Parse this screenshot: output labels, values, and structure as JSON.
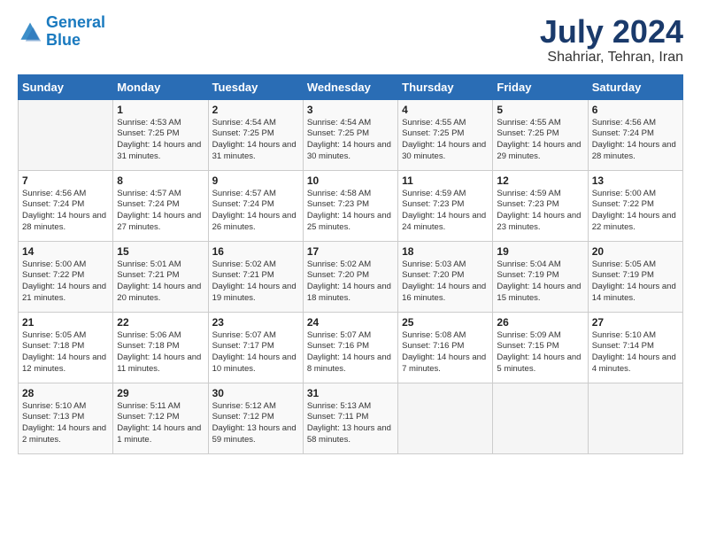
{
  "logo": {
    "line1": "General",
    "line2": "Blue"
  },
  "title": {
    "month_year": "July 2024",
    "location": "Shahriar, Tehran, Iran"
  },
  "headers": [
    "Sunday",
    "Monday",
    "Tuesday",
    "Wednesday",
    "Thursday",
    "Friday",
    "Saturday"
  ],
  "weeks": [
    [
      {
        "day": "",
        "sunrise": "",
        "sunset": "",
        "daylight": ""
      },
      {
        "day": "1",
        "sunrise": "Sunrise: 4:53 AM",
        "sunset": "Sunset: 7:25 PM",
        "daylight": "Daylight: 14 hours and 31 minutes."
      },
      {
        "day": "2",
        "sunrise": "Sunrise: 4:54 AM",
        "sunset": "Sunset: 7:25 PM",
        "daylight": "Daylight: 14 hours and 31 minutes."
      },
      {
        "day": "3",
        "sunrise": "Sunrise: 4:54 AM",
        "sunset": "Sunset: 7:25 PM",
        "daylight": "Daylight: 14 hours and 30 minutes."
      },
      {
        "day": "4",
        "sunrise": "Sunrise: 4:55 AM",
        "sunset": "Sunset: 7:25 PM",
        "daylight": "Daylight: 14 hours and 30 minutes."
      },
      {
        "day": "5",
        "sunrise": "Sunrise: 4:55 AM",
        "sunset": "Sunset: 7:25 PM",
        "daylight": "Daylight: 14 hours and 29 minutes."
      },
      {
        "day": "6",
        "sunrise": "Sunrise: 4:56 AM",
        "sunset": "Sunset: 7:24 PM",
        "daylight": "Daylight: 14 hours and 28 minutes."
      }
    ],
    [
      {
        "day": "7",
        "sunrise": "Sunrise: 4:56 AM",
        "sunset": "Sunset: 7:24 PM",
        "daylight": "Daylight: 14 hours and 28 minutes."
      },
      {
        "day": "8",
        "sunrise": "Sunrise: 4:57 AM",
        "sunset": "Sunset: 7:24 PM",
        "daylight": "Daylight: 14 hours and 27 minutes."
      },
      {
        "day": "9",
        "sunrise": "Sunrise: 4:57 AM",
        "sunset": "Sunset: 7:24 PM",
        "daylight": "Daylight: 14 hours and 26 minutes."
      },
      {
        "day": "10",
        "sunrise": "Sunrise: 4:58 AM",
        "sunset": "Sunset: 7:23 PM",
        "daylight": "Daylight: 14 hours and 25 minutes."
      },
      {
        "day": "11",
        "sunrise": "Sunrise: 4:59 AM",
        "sunset": "Sunset: 7:23 PM",
        "daylight": "Daylight: 14 hours and 24 minutes."
      },
      {
        "day": "12",
        "sunrise": "Sunrise: 4:59 AM",
        "sunset": "Sunset: 7:23 PM",
        "daylight": "Daylight: 14 hours and 23 minutes."
      },
      {
        "day": "13",
        "sunrise": "Sunrise: 5:00 AM",
        "sunset": "Sunset: 7:22 PM",
        "daylight": "Daylight: 14 hours and 22 minutes."
      }
    ],
    [
      {
        "day": "14",
        "sunrise": "Sunrise: 5:00 AM",
        "sunset": "Sunset: 7:22 PM",
        "daylight": "Daylight: 14 hours and 21 minutes."
      },
      {
        "day": "15",
        "sunrise": "Sunrise: 5:01 AM",
        "sunset": "Sunset: 7:21 PM",
        "daylight": "Daylight: 14 hours and 20 minutes."
      },
      {
        "day": "16",
        "sunrise": "Sunrise: 5:02 AM",
        "sunset": "Sunset: 7:21 PM",
        "daylight": "Daylight: 14 hours and 19 minutes."
      },
      {
        "day": "17",
        "sunrise": "Sunrise: 5:02 AM",
        "sunset": "Sunset: 7:20 PM",
        "daylight": "Daylight: 14 hours and 18 minutes."
      },
      {
        "day": "18",
        "sunrise": "Sunrise: 5:03 AM",
        "sunset": "Sunset: 7:20 PM",
        "daylight": "Daylight: 14 hours and 16 minutes."
      },
      {
        "day": "19",
        "sunrise": "Sunrise: 5:04 AM",
        "sunset": "Sunset: 7:19 PM",
        "daylight": "Daylight: 14 hours and 15 minutes."
      },
      {
        "day": "20",
        "sunrise": "Sunrise: 5:05 AM",
        "sunset": "Sunset: 7:19 PM",
        "daylight": "Daylight: 14 hours and 14 minutes."
      }
    ],
    [
      {
        "day": "21",
        "sunrise": "Sunrise: 5:05 AM",
        "sunset": "Sunset: 7:18 PM",
        "daylight": "Daylight: 14 hours and 12 minutes."
      },
      {
        "day": "22",
        "sunrise": "Sunrise: 5:06 AM",
        "sunset": "Sunset: 7:18 PM",
        "daylight": "Daylight: 14 hours and 11 minutes."
      },
      {
        "day": "23",
        "sunrise": "Sunrise: 5:07 AM",
        "sunset": "Sunset: 7:17 PM",
        "daylight": "Daylight: 14 hours and 10 minutes."
      },
      {
        "day": "24",
        "sunrise": "Sunrise: 5:07 AM",
        "sunset": "Sunset: 7:16 PM",
        "daylight": "Daylight: 14 hours and 8 minutes."
      },
      {
        "day": "25",
        "sunrise": "Sunrise: 5:08 AM",
        "sunset": "Sunset: 7:16 PM",
        "daylight": "Daylight: 14 hours and 7 minutes."
      },
      {
        "day": "26",
        "sunrise": "Sunrise: 5:09 AM",
        "sunset": "Sunset: 7:15 PM",
        "daylight": "Daylight: 14 hours and 5 minutes."
      },
      {
        "day": "27",
        "sunrise": "Sunrise: 5:10 AM",
        "sunset": "Sunset: 7:14 PM",
        "daylight": "Daylight: 14 hours and 4 minutes."
      }
    ],
    [
      {
        "day": "28",
        "sunrise": "Sunrise: 5:10 AM",
        "sunset": "Sunset: 7:13 PM",
        "daylight": "Daylight: 14 hours and 2 minutes."
      },
      {
        "day": "29",
        "sunrise": "Sunrise: 5:11 AM",
        "sunset": "Sunset: 7:12 PM",
        "daylight": "Daylight: 14 hours and 1 minute."
      },
      {
        "day": "30",
        "sunrise": "Sunrise: 5:12 AM",
        "sunset": "Sunset: 7:12 PM",
        "daylight": "Daylight: 13 hours and 59 minutes."
      },
      {
        "day": "31",
        "sunrise": "Sunrise: 5:13 AM",
        "sunset": "Sunset: 7:11 PM",
        "daylight": "Daylight: 13 hours and 58 minutes."
      },
      {
        "day": "",
        "sunrise": "",
        "sunset": "",
        "daylight": ""
      },
      {
        "day": "",
        "sunrise": "",
        "sunset": "",
        "daylight": ""
      },
      {
        "day": "",
        "sunrise": "",
        "sunset": "",
        "daylight": ""
      }
    ]
  ]
}
